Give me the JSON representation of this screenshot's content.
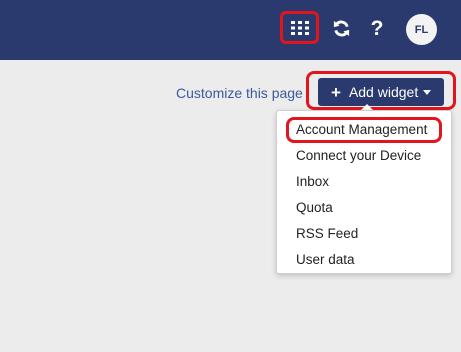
{
  "header": {
    "background_color": "#2b3a6e",
    "apps_icon": "grid-icon",
    "refresh_icon": "refresh-icon",
    "help_label": "?",
    "avatar_initials": "FL"
  },
  "toolbar": {
    "customize_label": "Customize this page",
    "add_widget_label": "Add widget"
  },
  "widget_menu": {
    "items": [
      {
        "label": "Account Management"
      },
      {
        "label": "Connect your Device"
      },
      {
        "label": "Inbox"
      },
      {
        "label": "Quota"
      },
      {
        "label": "RSS Feed"
      },
      {
        "label": "User data"
      }
    ]
  },
  "highlight_color": "#e3151c"
}
